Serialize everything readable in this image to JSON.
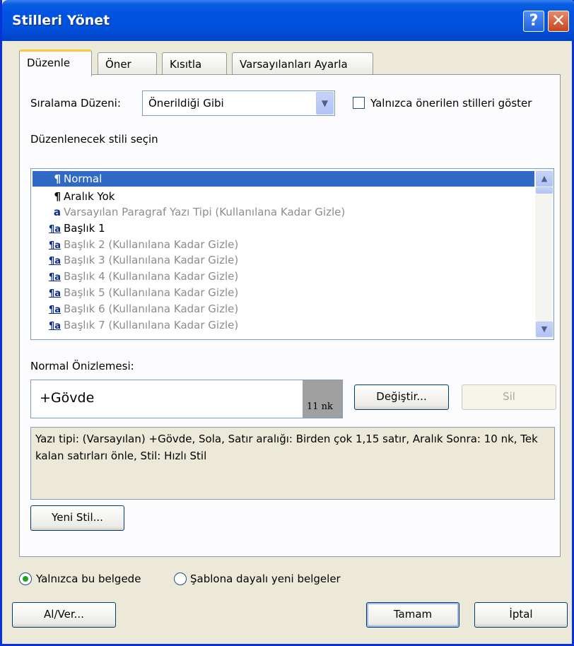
{
  "window": {
    "title": "Stilleri Yönet"
  },
  "title_buttons": {
    "help": "?",
    "close": "✕"
  },
  "tabs": [
    {
      "label": "Düzenle"
    },
    {
      "label": "Öner"
    },
    {
      "label": "Kısıtla"
    },
    {
      "label": "Varsayılanları Ayarla"
    }
  ],
  "sort": {
    "label": "Sıralama Düzeni:",
    "value": "Önerildiği Gibi",
    "only_recommended_label": "Yalnızca önerilen stilleri göster",
    "only_recommended_checked": false
  },
  "style_list": {
    "label": "Düzenlenecek stili seçin",
    "items": [
      {
        "symbol": "¶",
        "label": "Normal",
        "selected": true
      },
      {
        "symbol": "¶",
        "label": "Aralık Yok"
      },
      {
        "symbol": "a",
        "label": "Varsayılan Paragraf Yazı Tipi  (Kullanılana Kadar Gizle)"
      },
      {
        "symbol": "¶a",
        "label": "Başlık 1"
      },
      {
        "symbol": "¶a",
        "label": "Başlık 2  (Kullanılana Kadar Gizle)"
      },
      {
        "symbol": "¶a",
        "label": "Başlık 3  (Kullanılana Kadar Gizle)"
      },
      {
        "symbol": "¶a",
        "label": "Başlık 4  (Kullanılana Kadar Gizle)"
      },
      {
        "symbol": "¶a",
        "label": "Başlık 5  (Kullanılana Kadar Gizle)"
      },
      {
        "symbol": "¶a",
        "label": "Başlık 6  (Kullanılana Kadar Gizle)"
      },
      {
        "symbol": "¶a",
        "label": "Başlık 7  (Kullanılana Kadar Gizle)"
      }
    ]
  },
  "preview": {
    "label": "Normal Önizlemesi:",
    "font": "+Gövde",
    "size": "11 nk"
  },
  "buttons": {
    "modify": "Değiştir...",
    "delete": "Sil",
    "new_style": "Yeni Stil...",
    "import_export": "Al/Ver...",
    "ok": "Tamam",
    "cancel": "İptal"
  },
  "description": "Yazı tipi: (Varsayılan) +Gövde, Sola, Satır aralığı:  Birden çok 1,15 satır, Aralık Sonra: 10 nk, Tek kalan satırları önle, Stil: Hızlı Stil",
  "scope": {
    "this_document": "Yalnızca bu belgede",
    "new_documents": "Şablona dayalı yeni belgeler",
    "selected": "this_document"
  },
  "colors": {
    "titlebar": "#0054e3",
    "selection": "#316ac5",
    "dialog_bg": "#ece9d8",
    "tab_highlight": "#ffc83c"
  }
}
